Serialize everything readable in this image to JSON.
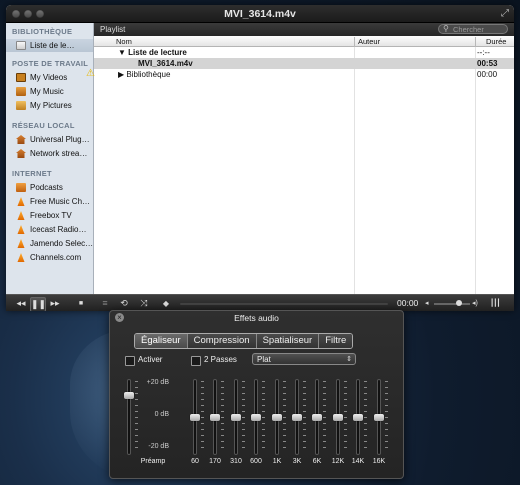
{
  "window": {
    "title": "MVI_3614.m4v"
  },
  "sidebar": {
    "sections": [
      {
        "label": "BIBLIOTHÈQUE",
        "items": [
          {
            "label": "Liste de le…",
            "icon": "playlist-icon",
            "selected": true
          }
        ]
      },
      {
        "label": "POSTE DE TRAVAIL",
        "items": [
          {
            "label": "My Videos",
            "icon": "film-icon"
          },
          {
            "label": "My Music",
            "icon": "music-icon"
          },
          {
            "label": "My Pictures",
            "icon": "pictures-icon"
          }
        ]
      },
      {
        "label": "RÉSEAU LOCAL",
        "items": [
          {
            "label": "Universal Plug…",
            "icon": "network-home-icon"
          },
          {
            "label": "Network strea…",
            "icon": "network-home-icon"
          }
        ]
      },
      {
        "label": "INTERNET",
        "items": [
          {
            "label": "Podcasts",
            "icon": "podcast-icon"
          },
          {
            "label": "Free Music Ch…",
            "icon": "cone-icon"
          },
          {
            "label": "Freebox TV",
            "icon": "cone-icon"
          },
          {
            "label": "Icecast Radio…",
            "icon": "cone-icon"
          },
          {
            "label": "Jamendo Selec…",
            "icon": "cone-icon"
          },
          {
            "label": "Channels.com",
            "icon": "cone-icon"
          }
        ]
      }
    ]
  },
  "playlist": {
    "label": "Playlist",
    "search_placeholder": "Chercher",
    "columns": {
      "name": "Nom",
      "author": "Auteur",
      "duration": "Durée"
    },
    "rows": [
      {
        "name": "▼ Liste de lecture",
        "author": "",
        "duration": "--:--"
      },
      {
        "name": "MVI_3614.m4v",
        "author": "",
        "duration": "00:53",
        "selected": true
      },
      {
        "name": "▶ Bibliothèque",
        "author": "",
        "duration": "00:00",
        "warning": true
      }
    ]
  },
  "controls": {
    "rewind": "◂◂",
    "play_pause": "❚❚",
    "forward": "▸▸",
    "stop": "■",
    "playlist_toggle": "≡",
    "loop": "⟲",
    "shuffle": "⤨",
    "time": "00:00",
    "volume_low": "◂",
    "volume_high": "◂)",
    "fx": "┃┃┃"
  },
  "effects": {
    "title": "Effets audio",
    "tabs": [
      "Égaliseur",
      "Compression",
      "Spatialiseur",
      "Filtre"
    ],
    "active_tab": "Égaliseur",
    "enable_label": "Activer",
    "enabled": false,
    "two_pass_label": "2 Passes",
    "two_pass": false,
    "preset": "Plat",
    "db_labels": [
      "+20 dB",
      "0 dB",
      "-20 dB"
    ],
    "preamp_label": "Préamp",
    "preamp_value": 0.6,
    "bands": [
      {
        "label": "60",
        "value": 0
      },
      {
        "label": "170",
        "value": 0
      },
      {
        "label": "310",
        "value": 0
      },
      {
        "label": "600",
        "value": 0
      },
      {
        "label": "1K",
        "value": 0
      },
      {
        "label": "3K",
        "value": 0
      },
      {
        "label": "6K",
        "value": 0
      },
      {
        "label": "12K",
        "value": 0
      },
      {
        "label": "14K",
        "value": 0
      },
      {
        "label": "16K",
        "value": 0
      }
    ]
  }
}
